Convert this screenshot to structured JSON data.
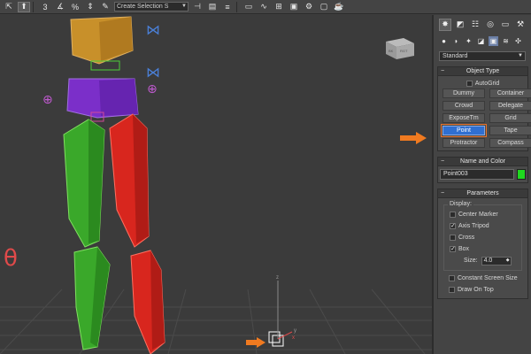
{
  "toolbar": {
    "icons": [
      "select-move-icon",
      "snap-3-icon",
      "angle-snap-icon",
      "percent-snap-icon",
      "spinner-snap-icon",
      "selection-set-icon",
      "mirror-icon",
      "align-icon",
      "layer-icon",
      "scene-explorer-icon",
      "curve-editor-icon",
      "schematic-icon",
      "material-editor-icon",
      "render-setup-icon",
      "render-frame-icon",
      "render-icon"
    ],
    "selection_set_placeholder": "Create Selection S"
  },
  "viewcube": {
    "label_left": "BK",
    "label_right": "RGT"
  },
  "axis_labels": {
    "x": "x",
    "y": "y",
    "z": "z"
  },
  "panel": {
    "dropdown_value": "Standard",
    "object_type": {
      "title": "Object Type",
      "autogrid_label": "AutoGrid",
      "autogrid_checked": false,
      "buttons": [
        {
          "label": "Dummy",
          "active": false
        },
        {
          "label": "Container",
          "active": false
        },
        {
          "label": "Crowd",
          "active": false
        },
        {
          "label": "Delegate",
          "active": false
        },
        {
          "label": "ExposeTm",
          "active": false
        },
        {
          "label": "Grid",
          "active": false
        },
        {
          "label": "Point",
          "active": true
        },
        {
          "label": "Tape",
          "active": false
        },
        {
          "label": "Protractor",
          "active": false
        },
        {
          "label": "Compass",
          "active": false
        }
      ]
    },
    "name_color": {
      "title": "Name and Color",
      "name_value": "Point003",
      "color": "#1fd81f"
    },
    "parameters": {
      "title": "Parameters",
      "display_label": "Display:",
      "options": [
        {
          "label": "Center Marker",
          "checked": false
        },
        {
          "label": "Axis Tripod",
          "checked": true
        },
        {
          "label": "Cross",
          "checked": false
        },
        {
          "label": "Box",
          "checked": true
        }
      ],
      "size_label": "Size:",
      "size_value": "4.0",
      "extra_options": [
        {
          "label": "Constant Screen Size",
          "checked": false
        },
        {
          "label": "Draw On Top",
          "checked": false
        }
      ]
    }
  },
  "colors": {
    "accent_orange": "#f07a20",
    "active_blue": "#2f6fd1",
    "bone_orange": "#c8902a",
    "bone_purple": "#7b2fc9",
    "bone_green": "#3aa82a",
    "bone_red": "#d8261e",
    "helper_blue": "#4a7fd6",
    "helper_pink": "#c05ad0",
    "foot_red": "#e04a4a"
  }
}
